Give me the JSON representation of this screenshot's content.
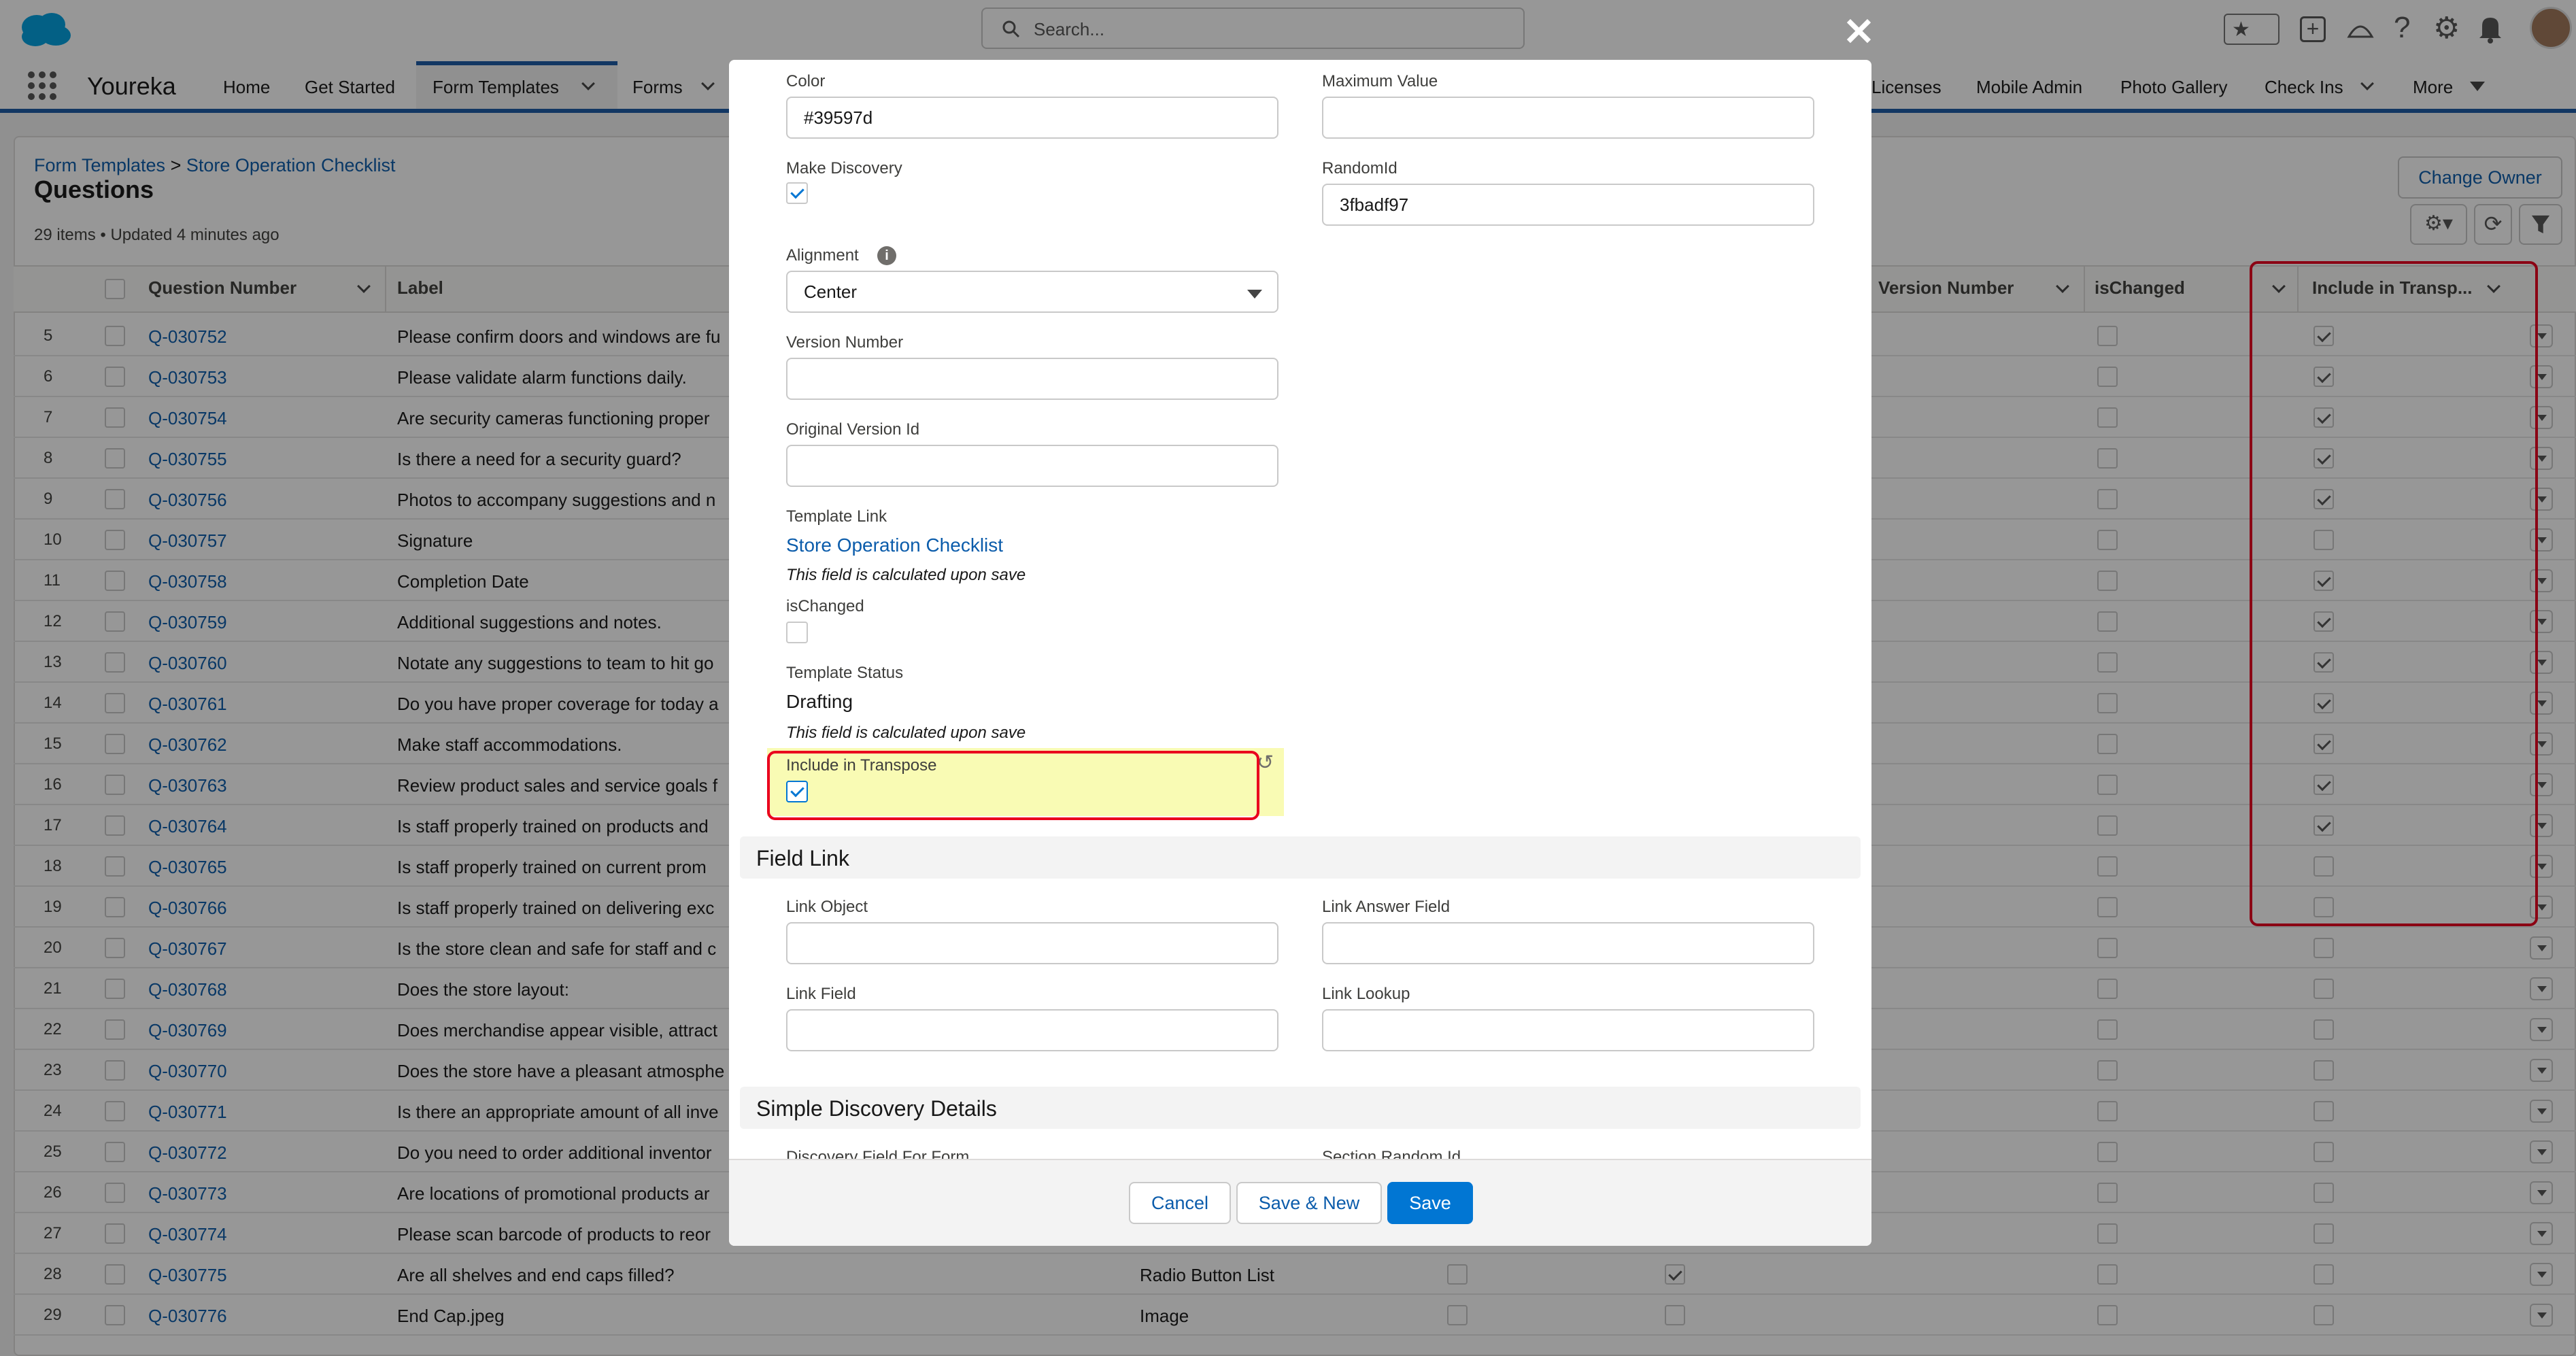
{
  "header": {
    "search_placeholder": "Search...",
    "app_name": "Youreka",
    "nav_items": [
      "Home",
      "Get Started",
      "Form Templates",
      "Forms",
      "Licenses",
      "Mobile Admin",
      "Photo Gallery",
      "Check Ins",
      "More"
    ]
  },
  "list": {
    "breadcrumb": "Form Templates > Store Operation Checklist",
    "breadcrumb_parent": "Form Templates",
    "breadcrumb_current": "Store Operation Checklist",
    "title": "Questions",
    "meta": "29 items • Updated 4 minutes ago",
    "change_owner": "Change Owner",
    "columns": {
      "question_number": "Question Number",
      "label": "Label",
      "version_number": "Version Number",
      "is_changed": "isChanged",
      "include_in_transpose": "Include in Transp..."
    },
    "rows": [
      {
        "n": "5",
        "q": "Q-030752",
        "label": "Please confirm doors and windows are fu",
        "t": true
      },
      {
        "n": "6",
        "q": "Q-030753",
        "label": "Please validate alarm functions daily.",
        "t": true
      },
      {
        "n": "7",
        "q": "Q-030754",
        "label": "Are security cameras functioning proper",
        "t": true
      },
      {
        "n": "8",
        "q": "Q-030755",
        "label": "Is there a need for a security guard?",
        "t": true
      },
      {
        "n": "9",
        "q": "Q-030756",
        "label": "Photos to accompany suggestions and n",
        "t": true
      },
      {
        "n": "10",
        "q": "Q-030757",
        "label": "Signature",
        "t": false
      },
      {
        "n": "11",
        "q": "Q-030758",
        "label": "Completion Date",
        "t": true
      },
      {
        "n": "12",
        "q": "Q-030759",
        "label": "Additional suggestions and notes.",
        "t": true
      },
      {
        "n": "13",
        "q": "Q-030760",
        "label": "Notate any suggestions to team to hit go",
        "t": true
      },
      {
        "n": "14",
        "q": "Q-030761",
        "label": "Do you have proper coverage for today a",
        "t": true
      },
      {
        "n": "15",
        "q": "Q-030762",
        "label": "Make staff accommodations.",
        "t": true
      },
      {
        "n": "16",
        "q": "Q-030763",
        "label": "Review product sales and service goals f",
        "t": true
      },
      {
        "n": "17",
        "q": "Q-030764",
        "label": "Is staff properly trained on products and",
        "t": true
      },
      {
        "n": "18",
        "q": "Q-030765",
        "label": "Is staff properly trained on current prom",
        "t": false
      },
      {
        "n": "19",
        "q": "Q-030766",
        "label": "Is staff properly trained on delivering exc",
        "t": false
      },
      {
        "n": "20",
        "q": "Q-030767",
        "label": "Is the store clean and safe for staff and c",
        "t": false
      },
      {
        "n": "21",
        "q": "Q-030768",
        "label": "Does the store layout:",
        "t": false
      },
      {
        "n": "22",
        "q": "Q-030769",
        "label": "Does merchandise appear visible, attract",
        "t": false
      },
      {
        "n": "23",
        "q": "Q-030770",
        "label": "Does the store have a pleasant atmosphe",
        "t": false
      },
      {
        "n": "24",
        "q": "Q-030771",
        "label": "Is there an appropriate amount of all inve",
        "t": false
      },
      {
        "n": "25",
        "q": "Q-030772",
        "label": "Do you need to order additional inventor",
        "t": false
      },
      {
        "n": "26",
        "q": "Q-030773",
        "label": "Are locations of promotional products ar",
        "t": false
      },
      {
        "n": "27",
        "q": "Q-030774",
        "label": "Please scan barcode of products to reor",
        "t": false
      },
      {
        "n": "28",
        "q": "Q-030775",
        "label": "Are all shelves and end caps filled?",
        "type": "Radio Button List",
        "t": false
      },
      {
        "n": "29",
        "q": "Q-030776",
        "label": "End Cap.jpeg",
        "type": "Image",
        "t": false
      }
    ]
  },
  "modal": {
    "color_label": "Color",
    "color_value": "#39597d",
    "max_value_label": "Maximum Value",
    "max_value": "",
    "make_discovery_label": "Make Discovery",
    "random_id_label": "RandomId",
    "random_id_value": "3fbadf97",
    "alignment_label": "Alignment",
    "alignment_value": "Center",
    "version_number_label": "Version Number",
    "original_version_label": "Original Version Id",
    "template_link_label": "Template Link",
    "template_link_value": "Store Operation Checklist",
    "calc_note": "This field is calculated upon save",
    "is_changed_label": "isChanged",
    "template_status_label": "Template Status",
    "template_status_value": "Drafting",
    "include_transpose_label": "Include in Transpose",
    "field_link_section": "Field Link",
    "link_object_label": "Link Object",
    "link_answer_field_label": "Link Answer Field",
    "link_field_label": "Link Field",
    "link_lookup_label": "Link Lookup",
    "simple_discovery_section": "Simple Discovery Details",
    "discovery_field_label": "Discovery Field For Form",
    "section_random_id_label": "Section Random Id",
    "cancel": "Cancel",
    "save_new": "Save & New",
    "save": "Save"
  },
  "colors": {
    "brand": "#0176d3",
    "link": "#0b5cab",
    "highlight": "#f9fbb4",
    "annotation": "#ea001e"
  }
}
